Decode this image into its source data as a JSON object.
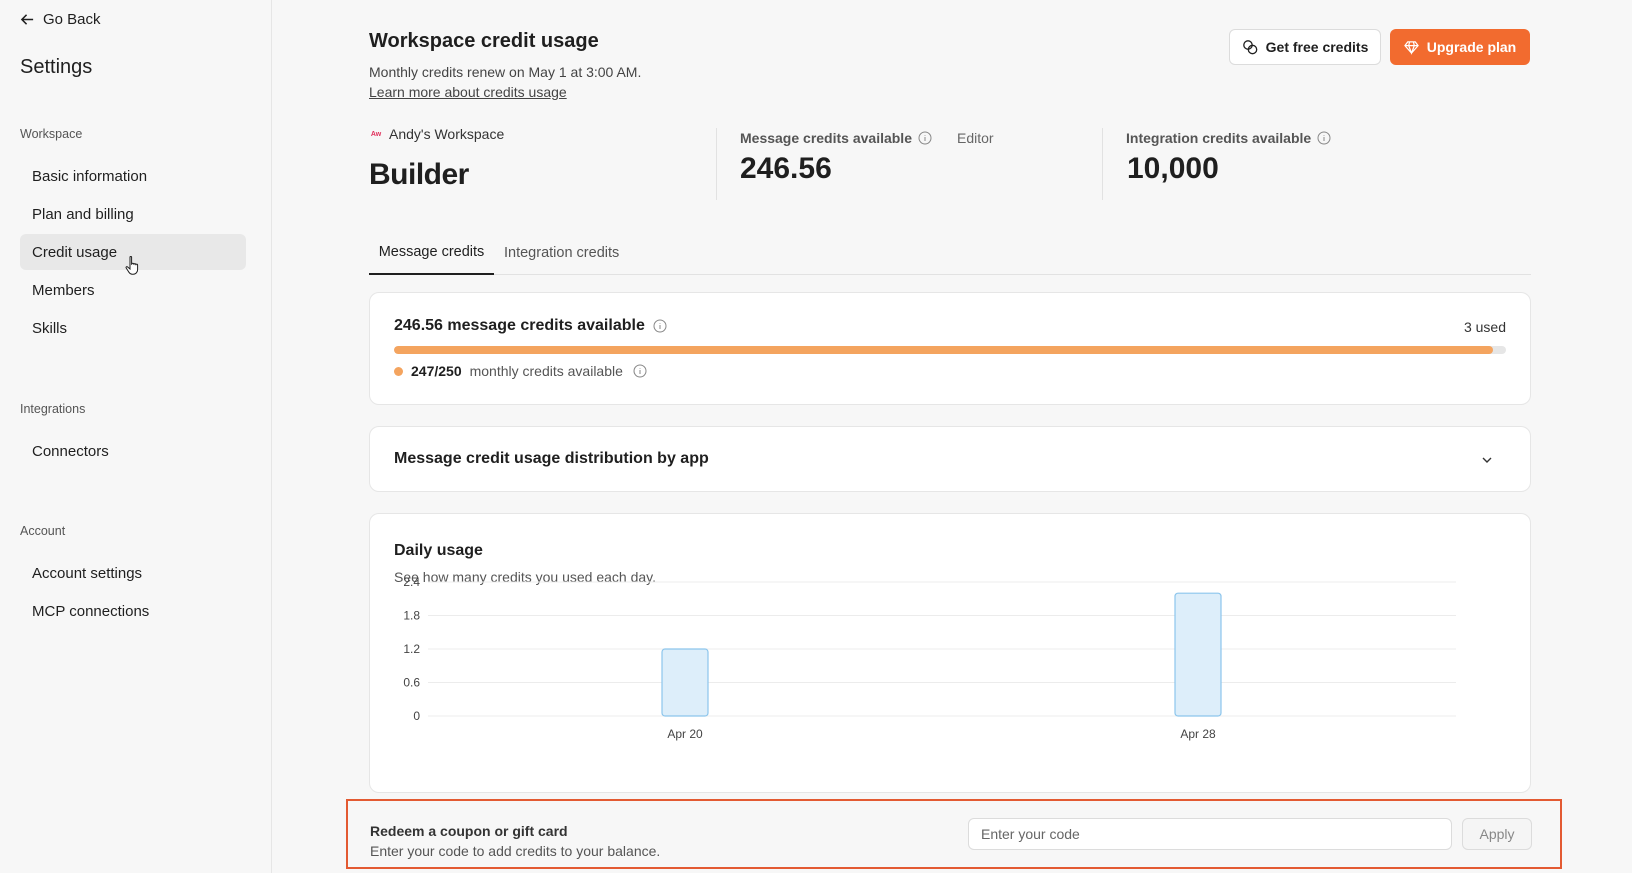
{
  "sidebar": {
    "go_back": "Go Back",
    "title": "Settings",
    "sections": [
      {
        "label": "Workspace",
        "items": [
          "Basic information",
          "Plan and billing",
          "Credit usage",
          "Members",
          "Skills"
        ]
      },
      {
        "label": "Integrations",
        "items": [
          "Connectors"
        ]
      },
      {
        "label": "Account",
        "items": [
          "Account settings",
          "MCP connections"
        ]
      }
    ],
    "active_item": "Credit usage"
  },
  "header": {
    "title": "Workspace credit usage",
    "renew_text": "Monthly credits renew on May 1 at 3:00 AM.",
    "learn_link": "Learn more about credits usage",
    "free_credits_label": "Get free credits",
    "upgrade_label": "Upgrade plan"
  },
  "workspace": {
    "logo_text": "Aw",
    "name": "Andy's Workspace",
    "plan": "Builder",
    "role": "Editor"
  },
  "stats": {
    "message_label": "Message credits available",
    "message_value": "246.56",
    "integration_label": "Integration credits available",
    "integration_value": "10,000"
  },
  "tabs": [
    {
      "label": "Message credits",
      "active": true
    },
    {
      "label": "Integration credits",
      "active": false
    }
  ],
  "credits_card": {
    "title": "246.56 message credits available",
    "used": "3 used",
    "progress_fraction": 0.988,
    "legend_count": "247/250",
    "legend_text": "monthly credits available"
  },
  "distribution_card": {
    "title": "Message credit usage distribution by app"
  },
  "chart_data": {
    "type": "bar",
    "title": "Daily usage",
    "subtitle": "See how many credits you used each day.",
    "categories": [
      "Apr 20",
      "Apr 28"
    ],
    "values": [
      1.2,
      2.2
    ],
    "yticks": [
      "0",
      "0.6",
      "1.2",
      "1.8",
      "2.4"
    ],
    "ylim": [
      0,
      2.4
    ],
    "grid": true,
    "colors": {
      "fill": "#ddeefa",
      "stroke": "#8cc5ec"
    }
  },
  "redeem": {
    "title": "Redeem a coupon or gift card",
    "subtitle": "Enter your code to add credits to your balance.",
    "placeholder": "Enter your code",
    "apply_label": "Apply"
  },
  "colors": {
    "accent": "#f26b2f",
    "progress": "#f4a45f",
    "highlight_border": "#e35a32"
  }
}
